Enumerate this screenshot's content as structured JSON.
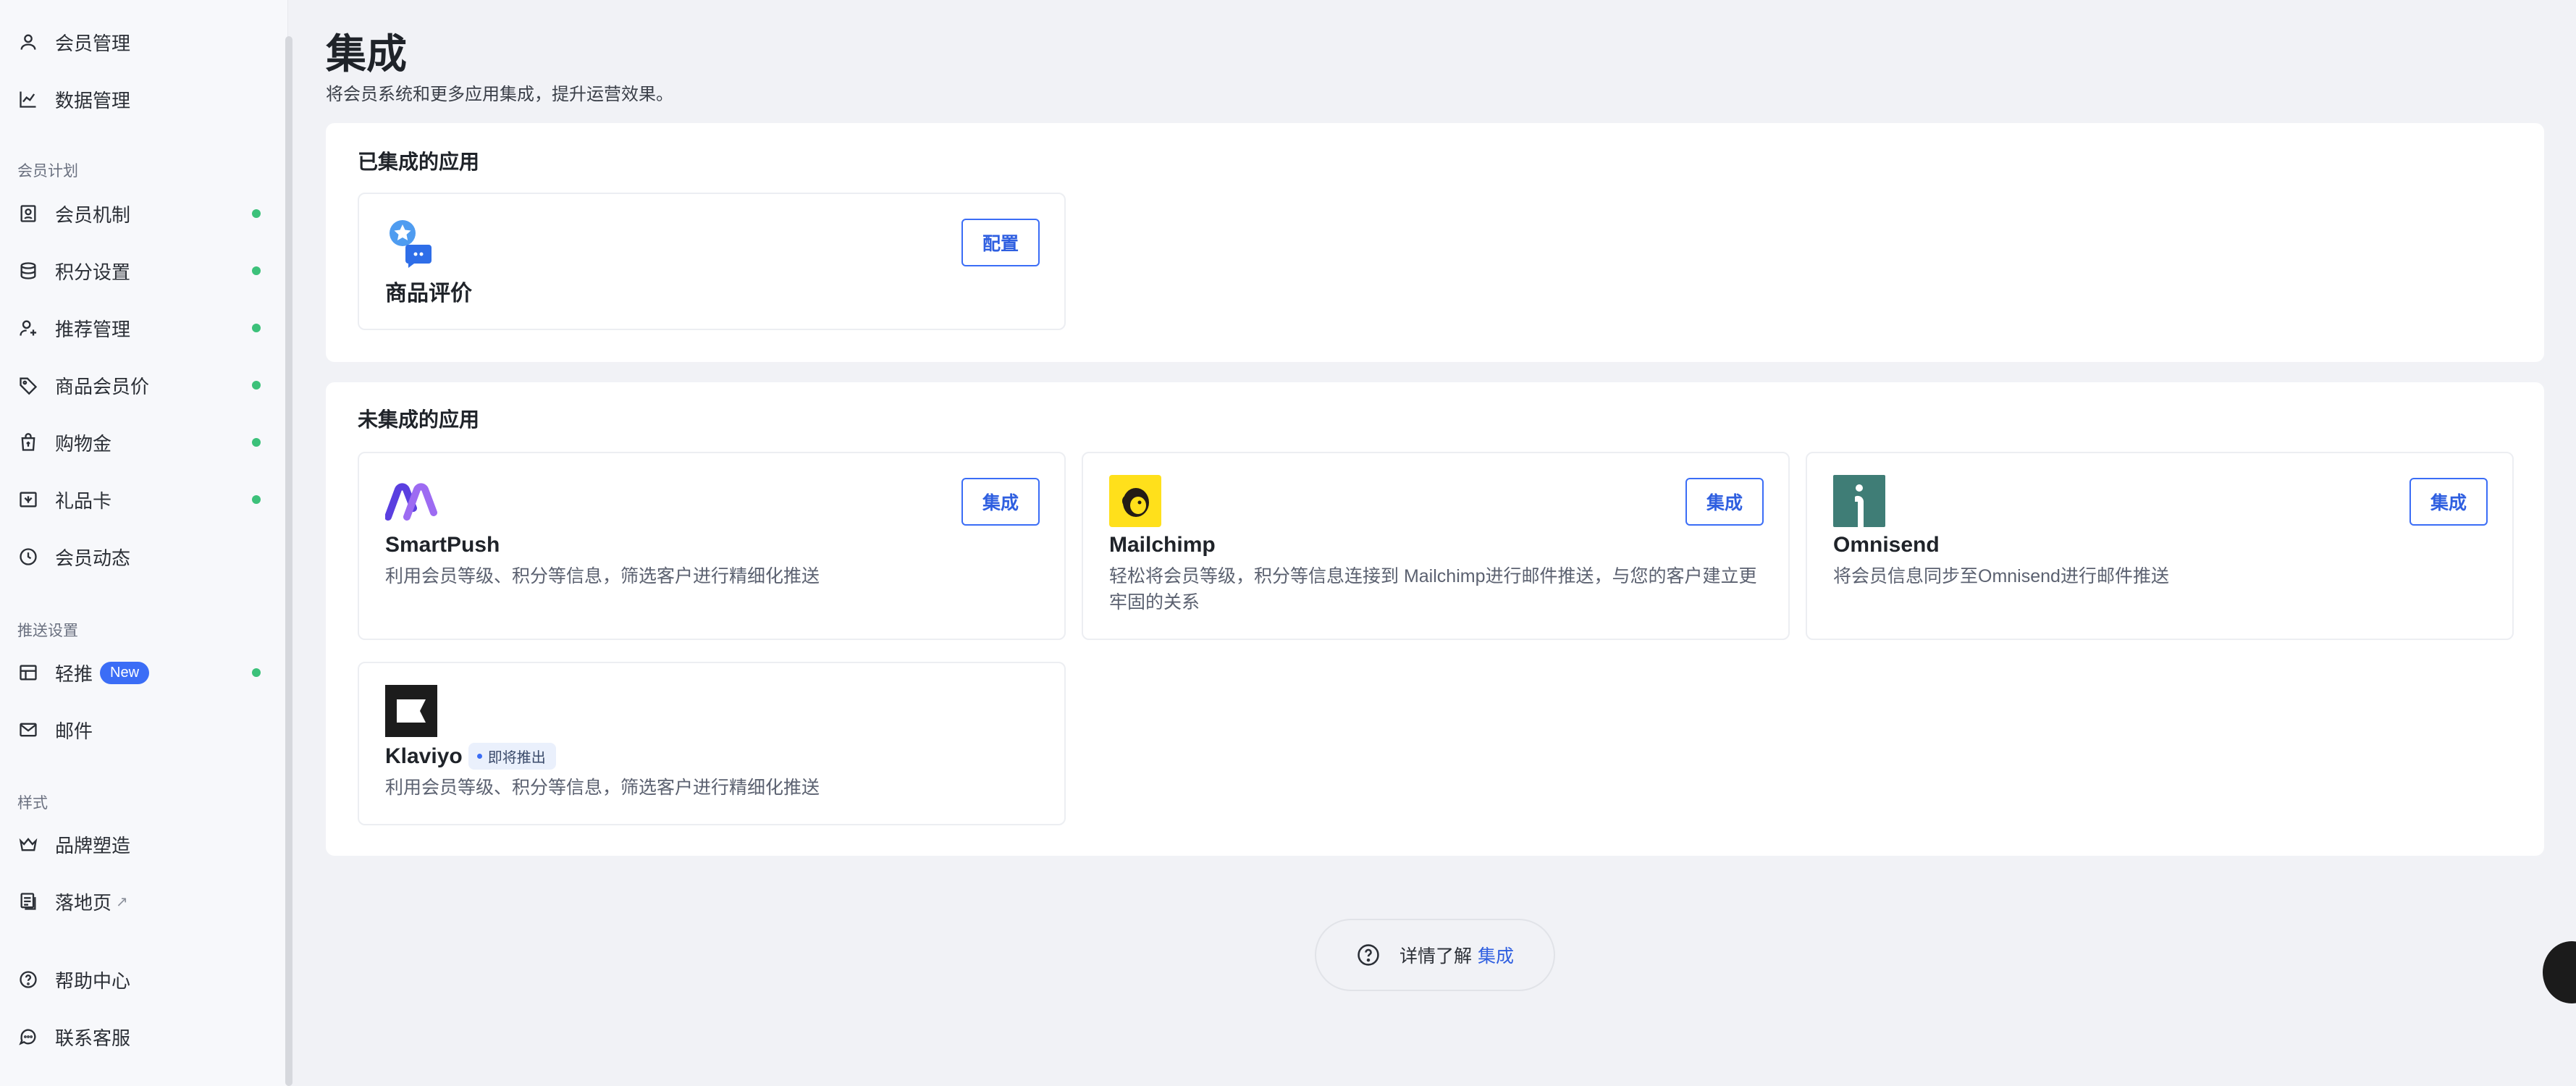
{
  "sidebar": {
    "items_top": [
      {
        "label": "会员管理",
        "icon": "user-icon"
      },
      {
        "label": "数据管理",
        "icon": "chart-line-icon"
      }
    ],
    "section_member_plan": "会员计划",
    "member_items": [
      {
        "label": "会员机制",
        "icon": "member-card-icon"
      },
      {
        "label": "积分设置",
        "icon": "database-icon"
      },
      {
        "label": "推荐管理",
        "icon": "user-plus-icon"
      },
      {
        "label": "商品会员价",
        "icon": "tag-icon"
      },
      {
        "label": "购物金",
        "icon": "shopping-bag-icon"
      },
      {
        "label": "礼品卡",
        "icon": "gift-card-icon"
      },
      {
        "label": "会员动态",
        "icon": "clock-icon"
      }
    ],
    "section_push": "推送设置",
    "push_items": [
      {
        "label": "轻推",
        "badge": "New",
        "icon": "push-icon"
      },
      {
        "label": "邮件",
        "icon": "mail-icon"
      }
    ],
    "section_style": "样式",
    "style_items": [
      {
        "label": "品牌塑造",
        "icon": "crown-icon"
      },
      {
        "label": "落地页",
        "icon": "landing-page-icon"
      }
    ],
    "bottom_items": [
      {
        "label": "帮助中心",
        "icon": "help-icon"
      },
      {
        "label": "联系客服",
        "icon": "chat-icon"
      }
    ],
    "status_color": "#3cc17a"
  },
  "header": {
    "title": "集成",
    "subtitle": "将会员系统和更多应用集成，提升运营效果。"
  },
  "integrated": {
    "title": "已集成的应用",
    "apps": [
      {
        "name": "商品评价",
        "button": "配置",
        "icon": "review-icon"
      }
    ]
  },
  "not_integrated": {
    "title": "未集成的应用",
    "apps": [
      {
        "name": "SmartPush",
        "desc": "利用会员等级、积分等信息，筛选客户进行精细化推送",
        "button": "集成",
        "icon": "smartpush-logo"
      },
      {
        "name": "Mailchimp",
        "desc": "轻松将会员等级，积分等信息连接到 Mailchimp进行邮件推送，与您的客户建立更牢固的关系",
        "button": "集成",
        "icon": "mailchimp-logo"
      },
      {
        "name": "Omnisend",
        "desc": "将会员信息同步至Omnisend进行邮件推送",
        "button": "集成",
        "icon": "omnisend-logo"
      },
      {
        "name": "Klaviyo",
        "tag": "即将推出",
        "desc": "利用会员等级、积分等信息，筛选客户进行精细化推送",
        "icon": "klaviyo-logo"
      }
    ]
  },
  "learn_more": {
    "text": "详情了解",
    "link": "集成"
  },
  "colors": {
    "accent": "#3b6df6",
    "background": "#f1f2f6"
  }
}
